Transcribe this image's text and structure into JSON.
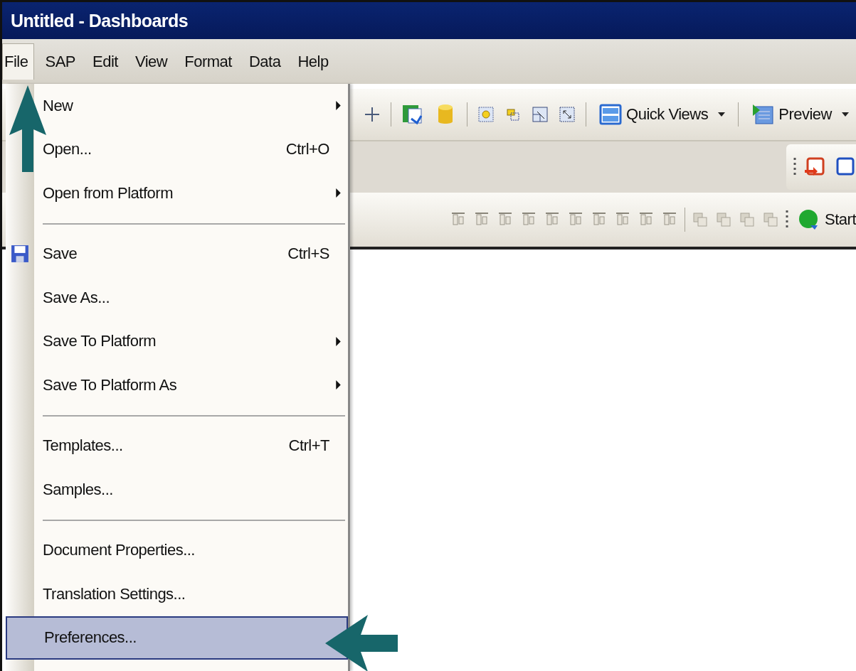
{
  "window": {
    "title": "Untitled - Dashboards"
  },
  "menubar": [
    {
      "label": "File",
      "selected": true
    },
    {
      "label": "SAP",
      "selected": false
    },
    {
      "label": "Edit",
      "selected": false
    },
    {
      "label": "View",
      "selected": false
    },
    {
      "label": "Format",
      "selected": false
    },
    {
      "label": "Data",
      "selected": false
    },
    {
      "label": "Help",
      "selected": false
    }
  ],
  "file_menu": [
    {
      "kind": "item",
      "label": "New",
      "submenu": true,
      "selected": false
    },
    {
      "kind": "item",
      "label": "Open...",
      "shortcut": "Ctrl+O",
      "selected": false
    },
    {
      "kind": "item",
      "label": "Open from Platform",
      "submenu": true,
      "selected": false
    },
    {
      "kind": "separator"
    },
    {
      "kind": "item",
      "label": "Save",
      "shortcut": "Ctrl+S",
      "icon": true,
      "selected": false
    },
    {
      "kind": "item",
      "label": "Save As...",
      "selected": false
    },
    {
      "kind": "item",
      "label": "Save To Platform",
      "submenu": true,
      "selected": false
    },
    {
      "kind": "item",
      "label": "Save To Platform As",
      "submenu": true,
      "selected": false
    },
    {
      "kind": "separator"
    },
    {
      "kind": "item",
      "label": "Templates...",
      "shortcut": "Ctrl+T",
      "selected": false
    },
    {
      "kind": "item",
      "label": "Samples...",
      "selected": false
    },
    {
      "kind": "separator"
    },
    {
      "kind": "item",
      "label": "Document Properties...",
      "selected": false
    },
    {
      "kind": "item",
      "label": "Translation Settings...",
      "selected": false
    },
    {
      "kind": "item",
      "label": "Preferences...",
      "selected": true
    }
  ],
  "toolbar": {
    "quick_views": "Quick Views",
    "preview": "Preview"
  },
  "format_toolbar": {
    "start": "Start"
  }
}
